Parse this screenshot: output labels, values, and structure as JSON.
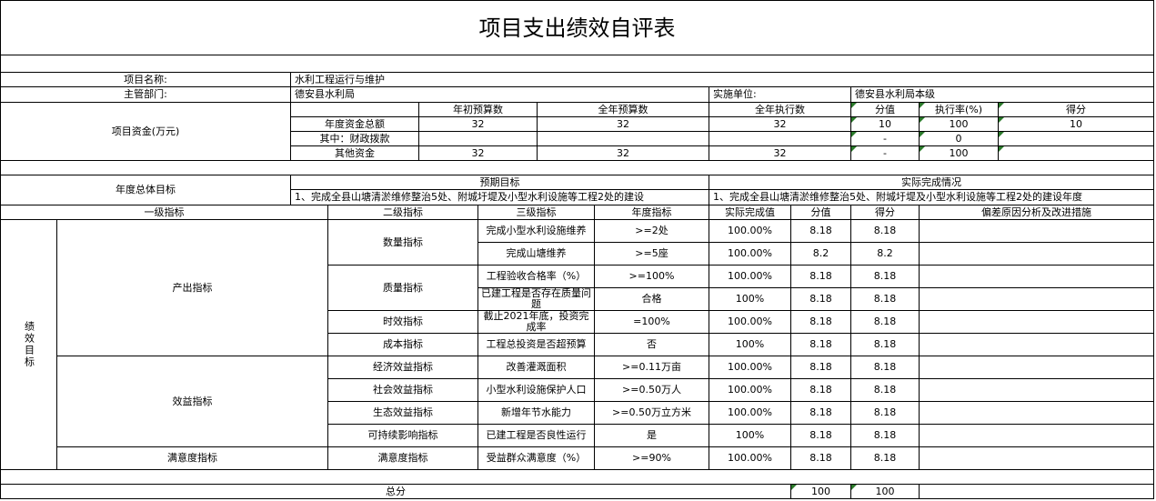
{
  "title": "项目支出绩效自评表",
  "info": {
    "project_name_label": "项目名称:",
    "project_name": "水利工程运行与维护",
    "dept_label": "主管部门:",
    "dept": "德安县水利局",
    "impl_label": "实施单位:",
    "impl": "德安县水利局本级"
  },
  "funds": {
    "label": "项目资金(万元)",
    "headers": [
      "年初预算数",
      "全年预算数",
      "全年执行数",
      "分值",
      "执行率(%)",
      "得分"
    ],
    "rows": [
      {
        "label": "年度资金总额",
        "initial": "32",
        "annual": "32",
        "executed": "32",
        "score_value": "10",
        "rate": "100",
        "score": "10"
      },
      {
        "label": "其中：财政拨款",
        "initial": "",
        "annual": "",
        "executed": "",
        "score_value": "-",
        "rate": "0",
        "score": ""
      },
      {
        "label": "其他资金",
        "initial": "32",
        "annual": "32",
        "executed": "32",
        "score_value": "-",
        "rate": "100",
        "score": ""
      }
    ]
  },
  "goals": {
    "label": "年度总体目标",
    "expected_header": "预期目标",
    "actual_header": "实际完成情况",
    "expected": "1、完成全县山塘清淤维修整治5处、附城圩堤及小型水利设施等工程2处的建设",
    "actual": "1、完成全县山塘清淤维修整治5处、附城圩堤及小型水利设施等工程2处的建设年度"
  },
  "perf": {
    "headers": [
      "一级指标",
      "二级指标",
      "三级指标",
      "年度指标",
      "实际完成值",
      "分值",
      "得分",
      "偏差原因分析及改进措施"
    ],
    "side_label": "绩效目标",
    "level1": [
      "产出指标",
      "效益指标",
      "满意度指标"
    ],
    "level2": [
      "数量指标",
      "质量指标",
      "时效指标",
      "成本指标",
      "经济效益指标",
      "社会效益指标",
      "生态效益指标",
      "可持续影响指标",
      "满意度指标"
    ],
    "rows": [
      {
        "l3": "完成小型水利设施维养",
        "target": ">=2处",
        "actual": "100.00%",
        "value": "8.18",
        "score": "8.18"
      },
      {
        "l3": "完成山塘维养",
        "target": ">=5座",
        "actual": "100.00%",
        "value": "8.2",
        "score": "8.2"
      },
      {
        "l3": "工程验收合格率（%）",
        "target": ">=100%",
        "actual": "100.00%",
        "value": "8.18",
        "score": "8.18"
      },
      {
        "l3": "已建工程是否存在质量问题",
        "target": "合格",
        "actual": "100%",
        "value": "8.18",
        "score": "8.18"
      },
      {
        "l3": "截止2021年底，投资完成率",
        "target": "=100%",
        "actual": "100.00%",
        "value": "8.18",
        "score": "8.18"
      },
      {
        "l3": "工程总投资是否超预算",
        "target": "否",
        "actual": "100%",
        "value": "8.18",
        "score": "8.18"
      },
      {
        "l3": "改善灌溉面积",
        "target": ">=0.11万亩",
        "actual": "100.00%",
        "value": "8.18",
        "score": "8.18"
      },
      {
        "l3": "小型水利设施保护人口",
        "target": ">=0.50万人",
        "actual": "100.00%",
        "value": "8.18",
        "score": "8.18"
      },
      {
        "l3": "新增年节水能力",
        "target": ">=0.50万立方米",
        "actual": "100.00%",
        "value": "8.18",
        "score": "8.18"
      },
      {
        "l3": "已建工程是否良性运行",
        "target": "是",
        "actual": "100%",
        "value": "8.18",
        "score": "8.18"
      },
      {
        "l3": "受益群众满意度（%）",
        "target": ">=90%",
        "actual": "100.00%",
        "value": "8.18",
        "score": "8.18"
      }
    ],
    "total_label": "总分",
    "total_value": "100",
    "total_score": "100"
  }
}
